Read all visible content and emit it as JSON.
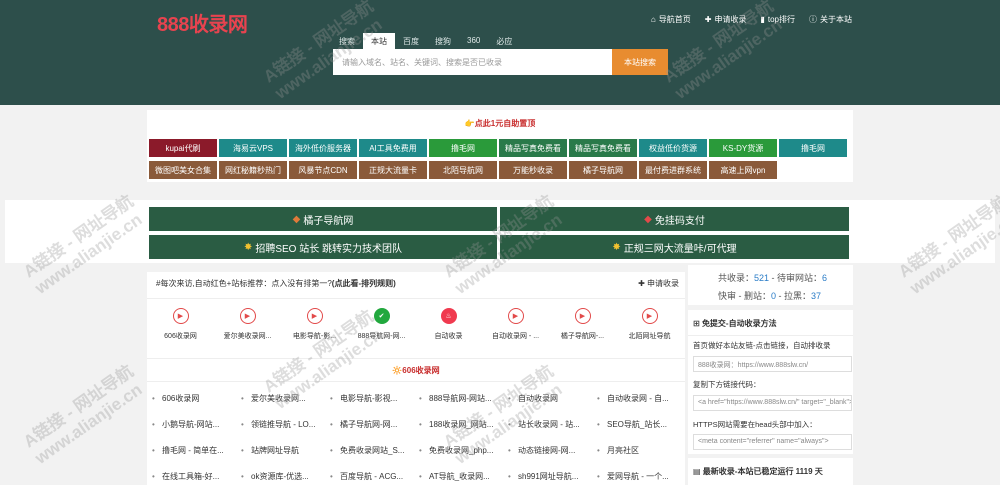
{
  "header": {
    "logo": "888收录网",
    "nav": [
      {
        "icon": "home-icon",
        "glyph": "⌂",
        "label": "导航首页"
      },
      {
        "icon": "plus-icon",
        "glyph": "✚",
        "label": "申请收录"
      },
      {
        "icon": "bar-chart-icon",
        "glyph": "▮",
        "label": "top排行"
      },
      {
        "icon": "info-icon",
        "glyph": "ⓘ",
        "label": "关于本站"
      }
    ],
    "search_tabs": [
      "搜索",
      "本站",
      "百度",
      "搜狗",
      "360",
      "必应"
    ],
    "search_active_tab": "本站",
    "search_placeholder": "请输入域名、站名、关键词、搜索是否已收录",
    "search_button": "本站搜索"
  },
  "promo": {
    "title": "👉点此1元自助置顶",
    "buttons_row1": [
      {
        "label": "kupai代刷",
        "color": "#8b1a2a"
      },
      {
        "label": "海易云VPS",
        "color": "#1e8a8a"
      },
      {
        "label": "海外低价服务器",
        "color": "#1e8a8a"
      },
      {
        "label": "AI工具免费用",
        "color": "#1e8a8a"
      },
      {
        "label": "撸毛网",
        "color": "#2a9a3a"
      },
      {
        "label": "精品写真免费看",
        "color": "#2a7a4a"
      },
      {
        "label": "精品写真免费看",
        "color": "#2a7a4a"
      },
      {
        "label": "权益低价货源",
        "color": "#1e8a8a"
      },
      {
        "label": "KS-DY货源",
        "color": "#2a9a3a"
      },
      {
        "label": "撸毛网",
        "color": "#1e8a8a"
      }
    ],
    "buttons_row2": [
      {
        "label": "微图吧美女合集",
        "color": "#8a5a3a"
      },
      {
        "label": "网红秘籍秒热门",
        "color": "#8a5a3a"
      },
      {
        "label": "风暴节点CDN",
        "color": "#8a5a3a"
      },
      {
        "label": "正规大流量卡",
        "color": "#8a5a3a"
      },
      {
        "label": "北陌导航网",
        "color": "#8a5a3a"
      },
      {
        "label": "万能秒收录",
        "color": "#8a5a3a"
      },
      {
        "label": "橘子导航网",
        "color": "#8a5a3a"
      },
      {
        "label": "最付费进群系统",
        "color": "#8a5a3a"
      },
      {
        "label": "高速上网vpn",
        "color": "#8a5a3a"
      }
    ]
  },
  "banners": [
    {
      "icon": "diamond-icon",
      "glyph": "◆",
      "label": "橘子导航网"
    },
    {
      "icon": "diamond-icon",
      "glyph": "◆",
      "label": "免挂码支付"
    },
    {
      "icon": "star-icon",
      "glyph": "✸",
      "label": "招聘SEO 站长 跳转实力技术团队"
    },
    {
      "icon": "star-icon",
      "glyph": "✸",
      "label": "正规三网大流量咔/可代理"
    }
  ],
  "main": {
    "notice_prefix": "#每次来访,自动红色+站标推荐：点入没有排第一?",
    "notice_link": "(点此看-排列规则)",
    "apply_label": "申请收录",
    "featured": [
      {
        "type": "play",
        "label": "606收录网"
      },
      {
        "type": "play",
        "label": "爱尔美收录网..."
      },
      {
        "type": "play",
        "label": "电影导航-影..."
      },
      {
        "type": "check",
        "label": "888导航网-网..."
      },
      {
        "type": "fire",
        "label": "自动收录"
      },
      {
        "type": "play",
        "label": "自动收录网 - ..."
      },
      {
        "type": "play",
        "label": "橘子导航网-..."
      },
      {
        "type": "play",
        "label": "北陌网址导航"
      }
    ],
    "section_title": "🔆606收录网",
    "links": [
      "606收录网",
      "爱尔美收录网...",
      "电影导航-影视...",
      "888导航网-网站...",
      "自动收录网",
      "自动收录网 - 自...",
      "小鹅导航-网站...",
      "领链推导航 - LO...",
      "橘子导航网-网...",
      "188收录网_网站...",
      "站长收录网 - 站...",
      "SEO导航_站长...",
      "撸毛网 - 简单在...",
      "站牌网址导航",
      "免费收录网站_S...",
      "免费收录网_php...",
      "动态链接网-网...",
      "月亮社区",
      "在线工具箱-好...",
      "ok资源库-优选...",
      "百度导航 - ACG...",
      "AT导航_收录网...",
      "sh991网址导航...",
      "爱网导航 - 一个..."
    ]
  },
  "stats": {
    "total_label": "共收录：",
    "total": "521",
    "pending_label": " - 待审网站：",
    "pending": "6",
    "snapshot_label": "快审 - 删站：",
    "deleted": "0",
    "blacklist_label": " - 拉黑：",
    "blacklist": "37"
  },
  "auto_link": {
    "title": "免提交-自动收录方法",
    "line1": "首页做好本站友链-点击链接，自动排收录",
    "input1": "888收录网：https://www.888slw.cn/",
    "line2": "复制下方链接代码：",
    "input2": "<a href=\"https://www.888slw.cn/\" target=\"_blank\">",
    "line3": "HTTPS网站需要在head头部中加入：",
    "input3": "<meta content=\"referrer\" name=\"always\">"
  },
  "latest": {
    "title": "最新收录-本站已稳定运行 1119 天"
  },
  "watermark": {
    "line1": "A链接 - 网址导航",
    "line2": "www.alianjie.cn"
  }
}
